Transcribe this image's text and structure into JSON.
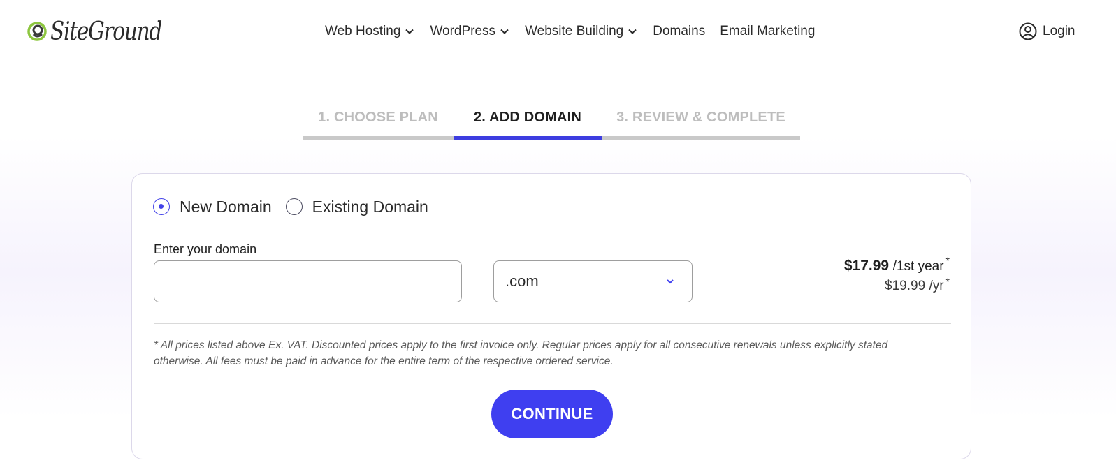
{
  "brand": {
    "name": "SiteGround",
    "accent": "#3f3ff0",
    "logo_green": "#8dc63f"
  },
  "nav": {
    "items": [
      {
        "label": "Web Hosting",
        "has_dropdown": true
      },
      {
        "label": "WordPress",
        "has_dropdown": true
      },
      {
        "label": "Website Building",
        "has_dropdown": true
      },
      {
        "label": "Domains",
        "has_dropdown": false
      },
      {
        "label": "Email Marketing",
        "has_dropdown": false
      }
    ],
    "login_label": "Login",
    "login_icon": "user-circle-icon"
  },
  "steps": [
    {
      "label": "1. CHOOSE PLAN",
      "state": "done"
    },
    {
      "label": "2. ADD DOMAIN",
      "state": "active"
    },
    {
      "label": "3. REVIEW & COMPLETE",
      "state": "upcoming"
    }
  ],
  "domain_form": {
    "options": [
      {
        "label": "New Domain",
        "checked": true
      },
      {
        "label": "Existing Domain",
        "checked": false
      }
    ],
    "input_label": "Enter your domain",
    "input_value": "",
    "input_placeholder": "",
    "tld_selected": ".com",
    "price": {
      "amount": "$17.99",
      "period": "/1st year",
      "asterisk": "*",
      "regular": "$19.99 /yr",
      "regular_asterisk": "*"
    },
    "disclaimer": "* All prices listed above Ex. VAT. Discounted prices apply to the first invoice only. Regular prices apply for all consecutive renewals unless explicitly stated otherwise. All fees must be paid in advance for the entire term of the respective ordered service.",
    "continue_label": "CONTINUE"
  }
}
